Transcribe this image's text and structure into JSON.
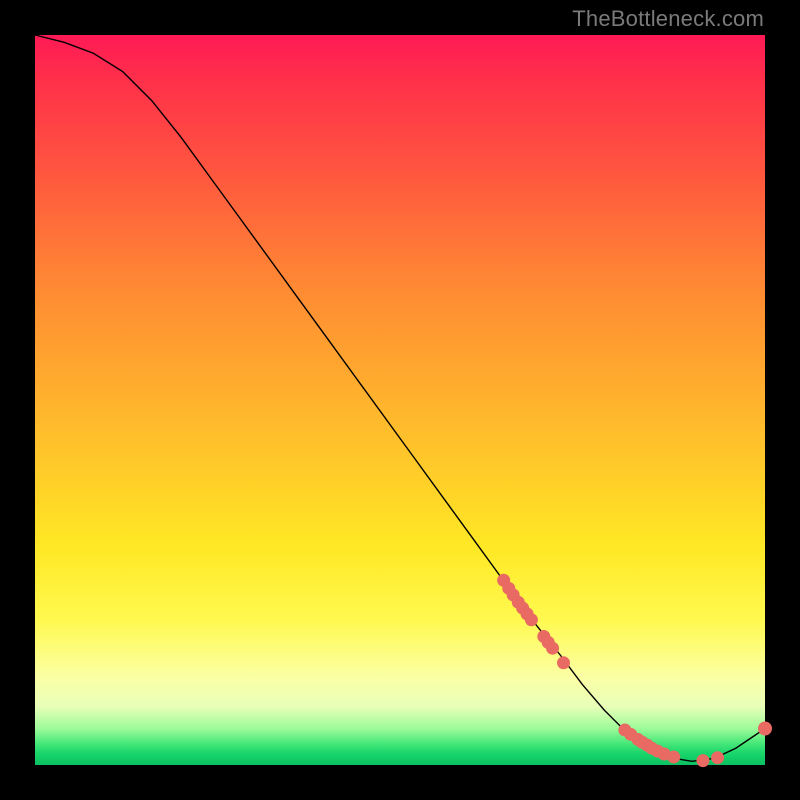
{
  "watermark": "TheBottleneck.com",
  "colors": {
    "dot": "#e86a62",
    "line": "#000000"
  },
  "chart_data": {
    "type": "line",
    "title": "",
    "xlabel": "",
    "ylabel": "",
    "xlim": [
      0,
      100
    ],
    "ylim": [
      0,
      100
    ],
    "grid": false,
    "legend": false,
    "series": [
      {
        "name": "bottleneck-curve",
        "x": [
          0,
          4,
          8,
          12,
          16,
          20,
          24,
          28,
          32,
          36,
          40,
          44,
          48,
          52,
          56,
          60,
          64,
          68,
          72,
          75,
          78,
          81,
          84,
          87,
          90,
          93,
          96,
          100
        ],
        "y": [
          100,
          99,
          97.5,
          95,
          91,
          86,
          80.5,
          75,
          69.5,
          64,
          58.5,
          53,
          47.5,
          42,
          36.5,
          31,
          25.5,
          20,
          15,
          11,
          7.5,
          4.5,
          2.3,
          1.0,
          0.5,
          0.9,
          2.3,
          5.0
        ]
      }
    ],
    "highlight_clusters": [
      {
        "name": "descending-cluster",
        "points": [
          {
            "x": 64.2,
            "y": 25.3
          },
          {
            "x": 64.9,
            "y": 24.2
          },
          {
            "x": 65.5,
            "y": 23.3
          },
          {
            "x": 66.2,
            "y": 22.3
          },
          {
            "x": 66.8,
            "y": 21.5
          },
          {
            "x": 67.4,
            "y": 20.7
          },
          {
            "x": 68.0,
            "y": 19.9
          },
          {
            "x": 69.7,
            "y": 17.6
          },
          {
            "x": 70.3,
            "y": 16.8
          },
          {
            "x": 70.9,
            "y": 16.0
          },
          {
            "x": 72.4,
            "y": 14.0
          }
        ]
      },
      {
        "name": "valley-cluster",
        "points": [
          {
            "x": 80.8,
            "y": 4.8
          },
          {
            "x": 81.6,
            "y": 4.2
          },
          {
            "x": 82.6,
            "y": 3.5
          },
          {
            "x": 83.2,
            "y": 3.1
          },
          {
            "x": 83.9,
            "y": 2.7
          },
          {
            "x": 84.5,
            "y": 2.3
          },
          {
            "x": 85.3,
            "y": 1.9
          },
          {
            "x": 86.2,
            "y": 1.5
          },
          {
            "x": 87.5,
            "y": 1.1
          },
          {
            "x": 91.5,
            "y": 0.6
          },
          {
            "x": 93.5,
            "y": 1.0
          }
        ]
      },
      {
        "name": "end-point",
        "points": [
          {
            "x": 100.0,
            "y": 5.0
          }
        ]
      }
    ]
  }
}
